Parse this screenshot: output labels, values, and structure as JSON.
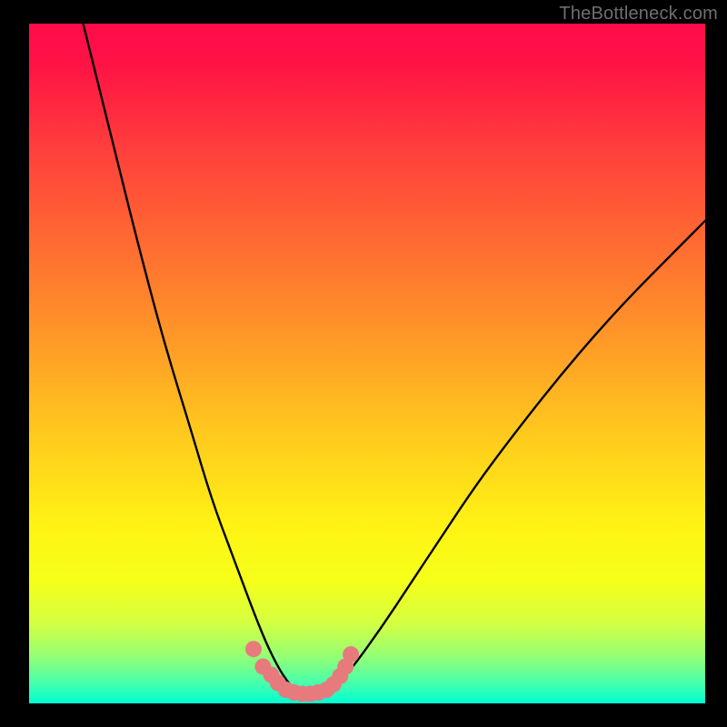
{
  "watermark": "TheBottleneck.com",
  "chart_data": {
    "type": "line",
    "title": "",
    "xlabel": "",
    "ylabel": "",
    "xlim": [
      0,
      100
    ],
    "ylim": [
      0,
      100
    ],
    "grid": false,
    "legend": false,
    "series": [
      {
        "name": "bottleneck-curve",
        "x": [
          8,
          12,
          16,
          20,
          24,
          27,
          30,
          33,
          35,
          37,
          38.5,
          40,
          42,
          44,
          46,
          48,
          52,
          56,
          60,
          66,
          72,
          80,
          88,
          96,
          100
        ],
        "y": [
          100,
          84,
          68,
          53,
          40,
          30,
          22,
          14,
          9,
          5,
          2.8,
          1.6,
          1.4,
          1.8,
          3.2,
          5.5,
          11,
          17,
          23,
          32,
          40,
          50,
          59,
          67,
          71
        ]
      }
    ],
    "markers": {
      "name": "highlight-dots",
      "color": "#e77a7d",
      "points_xy": [
        [
          33.2,
          8.0
        ],
        [
          34.6,
          5.4
        ],
        [
          35.8,
          4.2
        ],
        [
          36.8,
          3.0
        ],
        [
          38.0,
          2.0
        ],
        [
          39.2,
          1.6
        ],
        [
          40.4,
          1.4
        ],
        [
          41.6,
          1.4
        ],
        [
          42.8,
          1.6
        ],
        [
          44.0,
          2.0
        ],
        [
          45.0,
          2.8
        ],
        [
          46.0,
          4.0
        ],
        [
          46.8,
          5.4
        ],
        [
          47.6,
          7.2
        ]
      ]
    },
    "gradient_stops": [
      {
        "pos": 0.0,
        "color": "#ff0b4a"
      },
      {
        "pos": 0.18,
        "color": "#ff3d3c"
      },
      {
        "pos": 0.46,
        "color": "#ff9728"
      },
      {
        "pos": 0.74,
        "color": "#fff314"
      },
      {
        "pos": 0.93,
        "color": "#96ff74"
      },
      {
        "pos": 1.0,
        "color": "#00ffd2"
      }
    ]
  }
}
